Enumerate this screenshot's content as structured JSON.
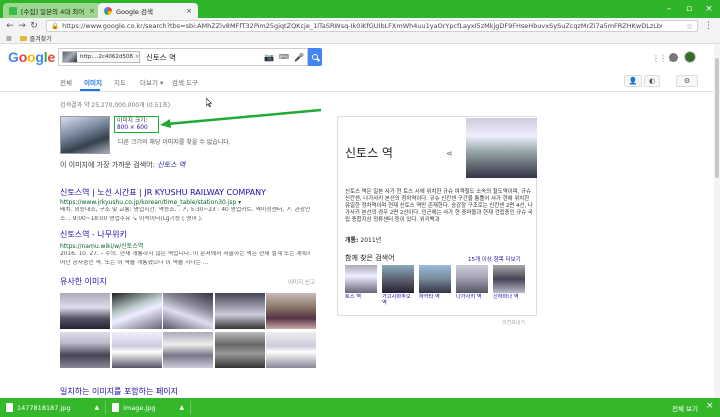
{
  "browser": {
    "tabs": [
      {
        "label": "[수집] 일본의 4대 최어"
      },
      {
        "label": "Google 검색"
      }
    ],
    "address": "https://www.google.co.kr/search?tbs=sbi:AMhZZiv8MFfT32Pim25giqtZQKcje_1lTaSRWsq-Ik0iKfGUIbLFXmWh4uu1yaOrYpcfLayxI5zMkjgDF9FHseHbuvxSySuZcqzMrZi7a5mFRZHKwDLzLb0tz-TG_1GLkevw_1qztzOUuwxSnFmivdhMaK4",
    "bookmarks_label": "즐겨찾기",
    "colors": {
      "chrome_green": "#2fb52a",
      "downloads_green": "#35b72c"
    }
  },
  "google": {
    "logo": "Google",
    "search_chip": "http:...2c4062d508",
    "query": "신토스 역",
    "nav": [
      "전체",
      "이미지",
      "지도",
      "더보기",
      "검색 도구"
    ]
  },
  "results": {
    "stats": "검색결과 약 25,270,000,000개 (0.51초)",
    "image_size_label": "이미지 크기:",
    "image_size_value": "800 × 600",
    "other_sizes": "다른 크기의 해당 이미지를 찾을 수 없습니다.",
    "best_guess_prefix": "이 이미지에 가장 가까운 검색어:",
    "best_guess_query": "신토스 역",
    "items": [
      {
        "title": "신토스역 | 노선 시간표 | JR KYUSHU RAILWAY COMPANY",
        "url": "https://www.jrkyushu.co.jp/korean/time_table/station30.jsp ▾",
        "snippet1": "배치. 외등대소, 구조 및 교통: 영업시간. 역등소. . ↗, 5:30~23 : 40 영업카트. 역미정센터, ↗. 관광안내",
        "snippet2": "소. , 9:00~18:00 영업주유 ↘ 이석이터(Lg기능 ( 영어 )."
      },
      {
        "title": "신토스역 - 나무위키",
        "url": "https://namu.wiki/w/신토스역",
        "snippet1": "2016. 10. 27. – 주의. 현재 개통하지 않은 역입니다. 이 문서에서 서술하는 역은 현재 설계 또는 계획하고",
        "snippet2": "어난 공사중인 역. 또는 이 역을 개통했으나 이 역을 지나는 ..."
      }
    ],
    "similar_title": "유사한 이미지",
    "similar_report": "이미지 신고",
    "partial_title": "일치하는 이미지를 포함하는 페이지"
  },
  "knowledge_panel": {
    "title": "신토스 역",
    "description": "신토스 역은 일본 사가 현 토스 시에 위치한 규슈 여객철도 소속의 철도역이며, 규슈 신칸센, 나가사키 본선의 정차역이다. 규슈 신칸센 구간을 통틀어 사가 현에 위치한 유일한 정차역이며 현재 신토스 역만 존재한다. 승강장 구조로는 신칸센 2면 4선, 나가사키 본선의 경우 2면 2선이다. 인근에는 사가 현 중마을과 현재 건립중인 규슈 국립 종합지상 정류센터 등이 있다. 위키백과",
    "wiki_link": "위키백과",
    "opened_label": "개통:",
    "opened_value": "2011년",
    "also_searched": "함께 찾은 검색어",
    "more": "15개 이상 항목 더보기",
    "related": [
      {
        "caption": "토스 역"
      },
      {
        "caption": "가고시마추오 역"
      },
      {
        "caption": "하카타 역"
      },
      {
        "caption": "나가사키 역"
      },
      {
        "caption": "신하마나 역"
      }
    ],
    "feedback": "의견보내기"
  },
  "downloads": {
    "files": [
      {
        "name": "1477818187.jpg"
      },
      {
        "name": "image.jpg"
      }
    ],
    "show_all": "전체 보기"
  }
}
